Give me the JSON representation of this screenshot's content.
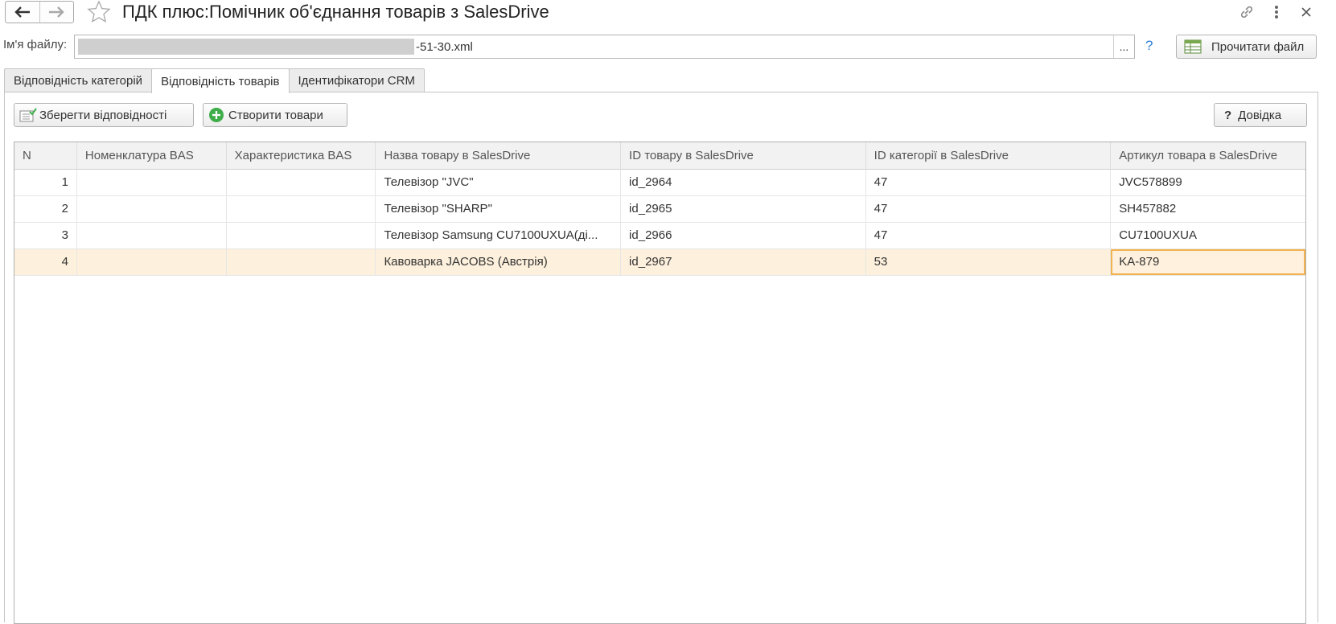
{
  "window": {
    "title": "ПДК плюс:Помічник об'єднання товарів з SalesDrive"
  },
  "file": {
    "label": "Ім'я файлу:",
    "value_visible": "-51-30.xml",
    "browse_label": "...",
    "help_label": "?",
    "read_button": "Прочитати файл"
  },
  "tabs": [
    {
      "label": "Відповідність категорій",
      "active": false
    },
    {
      "label": "Відповідність товарів",
      "active": true
    },
    {
      "label": "Ідентифікатори CRM",
      "active": false
    }
  ],
  "toolbar": {
    "save_label": "Зберегти відповідності",
    "create_label": "Створити товари",
    "help_label": "Довідка",
    "help_prefix": "?"
  },
  "table": {
    "columns": [
      "N",
      "Номенклатура BAS",
      "Характеристика BAS",
      "Назва товару в SalesDrive",
      "ID товару в SalesDrive",
      "ID категорії в SalesDrive",
      "Артикул товара в SalesDrive"
    ],
    "rows": [
      [
        "1",
        "",
        "",
        "Телевізор \"JVC\"",
        "id_2964",
        "47",
        "JVC578899"
      ],
      [
        "2",
        "",
        "",
        "Телевізор \"SHARP\"",
        "id_2965",
        "47",
        "SH457882"
      ],
      [
        "3",
        "",
        "",
        "Телевізор Samsung CU7100UXUA(ді...",
        "id_2966",
        "47",
        "CU7100UXUA"
      ],
      [
        "4",
        "",
        "",
        "Кавоварка JACOBS (Австрія)",
        "id_2967",
        "53",
        "KA-879"
      ]
    ],
    "selected_row": 4
  },
  "colors": {
    "selected_row": "#fdf0dc",
    "focus_border": "#f2b24d",
    "help_accent": "#2a7fd4",
    "create_icon": "#3fae4a"
  },
  "icons": {
    "back": "arrow-left-icon",
    "forward": "arrow-right-icon",
    "favorite": "star-icon",
    "link": "link-icon",
    "more": "more-vertical-icon",
    "close": "close-icon",
    "read": "table-icon",
    "save": "checklist-icon",
    "create": "plus-circle-icon"
  }
}
